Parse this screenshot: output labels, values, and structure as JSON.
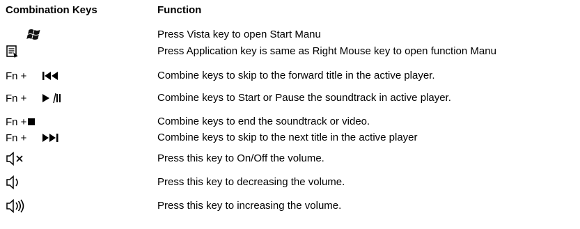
{
  "headers": {
    "keys": "Combination Keys",
    "function": "Function"
  },
  "fn_label": "Fn +",
  "rows": [
    {
      "icon": "windows-logo-icon",
      "desc": "Press Vista key to open Start Manu"
    },
    {
      "icon": "application-menu-icon",
      "desc": "Press Application key is same as Right Mouse key to open function Manu"
    },
    {
      "icon": "skip-back-icon",
      "desc": "Combine keys to skip to the forward title in the active player."
    },
    {
      "icon": "play-pause-icon",
      "desc": "Combine keys to Start or Pause the soundtrack in active player."
    },
    {
      "icon": "stop-icon",
      "desc": "Combine keys to end the soundtrack or video."
    },
    {
      "icon": "skip-forward-icon",
      "desc": "Combine keys to skip to the next title in the active player"
    },
    {
      "icon": "volume-mute-icon",
      "desc": "Press this key to On/Off the volume."
    },
    {
      "icon": "volume-down-icon",
      "desc": "Press this key to decreasing the volume."
    },
    {
      "icon": "volume-up-icon",
      "desc": "Press this key to increasing the volume."
    }
  ]
}
